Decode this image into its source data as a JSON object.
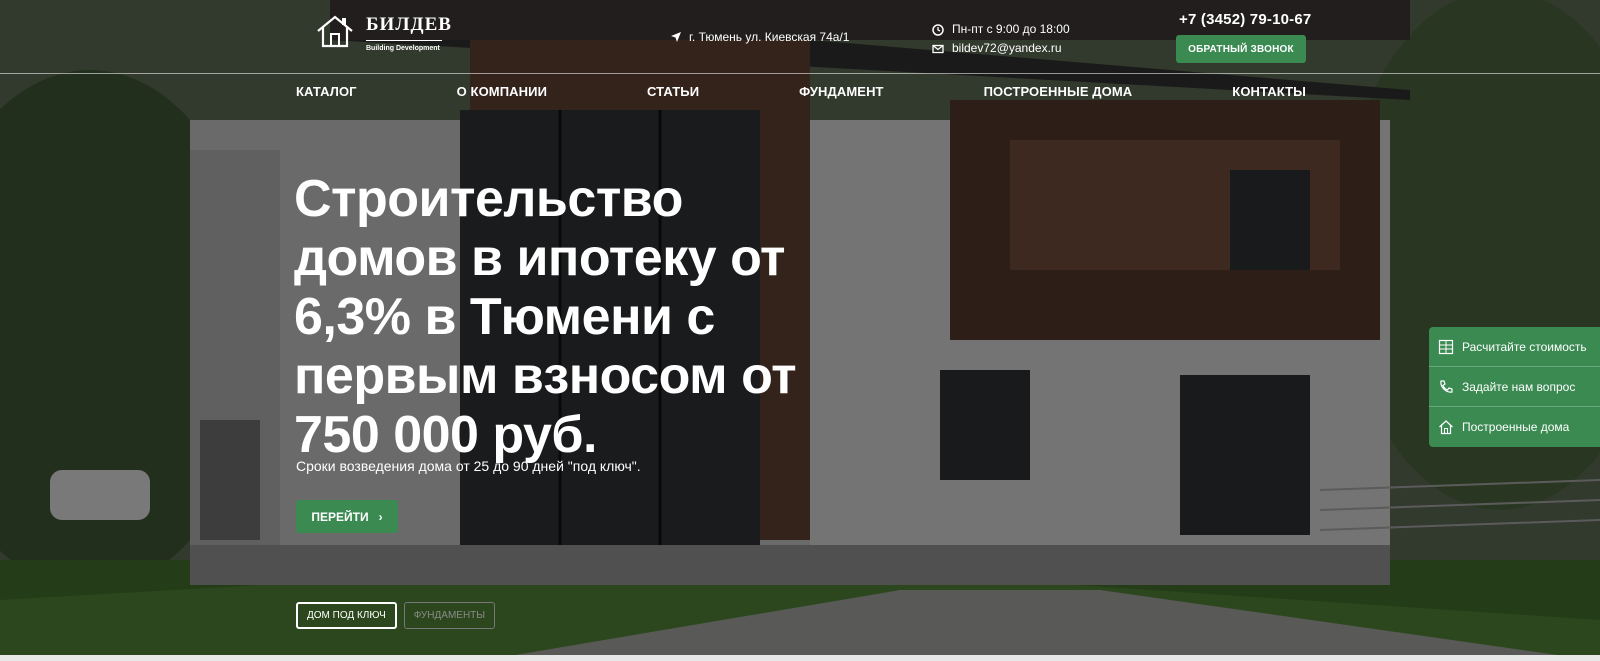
{
  "header": {
    "logo": {
      "name": "БИЛДЕВ",
      "subtitle": "Building Development",
      "icon": "house-icon"
    },
    "address": "г. Тюмень ул. Киевская 74а/1",
    "hours": "Пн-пт с 9:00 до 18:00",
    "email": "bildev72@yandex.ru",
    "phone": "+7 (3452) 79-10-67",
    "callback_label": "ОБРАТНЫЙ ЗВОНОК"
  },
  "nav": {
    "items": [
      "КАТАЛОГ",
      "О КОМПАНИИ",
      "СТАТЬИ",
      "ФУНДАМЕНТ",
      "ПОСТРОЕННЫЕ ДОМА",
      "КОНТАКТЫ"
    ]
  },
  "hero": {
    "title_lines": [
      "Строительство",
      "домов в ипотеку от",
      "6,3% в Тюмени с",
      "первым взносом от",
      "750 000 руб."
    ],
    "subtitle": "Сроки возведения дома от 25 до 90 дней \"под ключ\".",
    "cta_label": "ПЕРЕЙТИ",
    "tabs": [
      {
        "label": "ДОМ ПОД КЛЮЧ",
        "active": true
      },
      {
        "label": "ФУНДАМЕНТЫ",
        "active": false
      }
    ]
  },
  "side_panel": {
    "items": [
      {
        "label": "Расчитайте стоимость",
        "icon": "calculator-icon"
      },
      {
        "label": "Задайте нам вопрос",
        "icon": "phone-icon"
      },
      {
        "label": "Построенные дома",
        "icon": "house-icon"
      }
    ]
  },
  "colors": {
    "accent": "#3a8a52",
    "text": "#ffffff"
  }
}
